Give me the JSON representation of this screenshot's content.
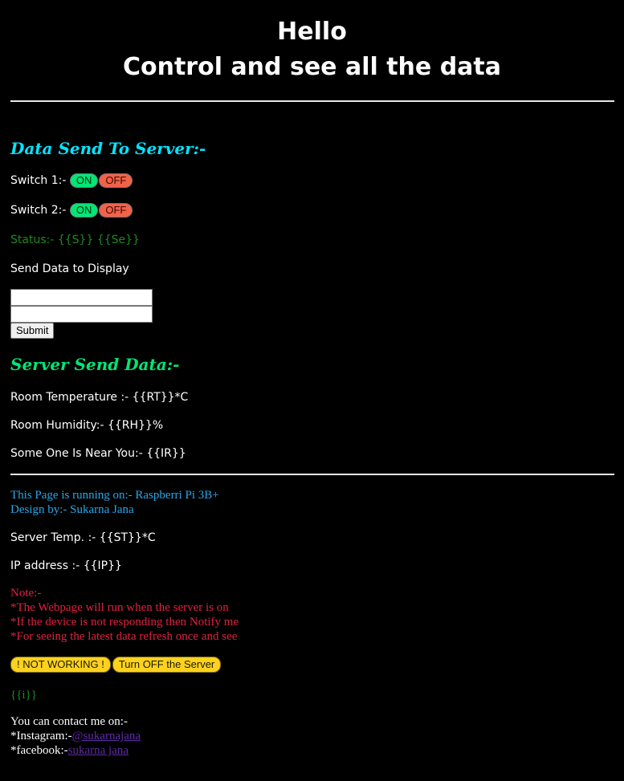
{
  "header": {
    "title": "Hello",
    "subtitle": "Control and see all the data"
  },
  "send_section": {
    "heading": "Data Send To Server:-",
    "switches": [
      {
        "label": "Switch 1:-",
        "on_label": "ON",
        "off_label": "OFF"
      },
      {
        "label": "Switch 2:-",
        "on_label": "ON",
        "off_label": "OFF"
      }
    ],
    "status": "Status:- {{S}} {{Se}}",
    "display_label": "Send Data to Display",
    "field1": {
      "value": "",
      "placeholder": ""
    },
    "field2": {
      "value": "",
      "placeholder": ""
    },
    "submit_label": "Submit"
  },
  "receive_section": {
    "heading": "Server Send Data:-",
    "room_temperature": "Room Temperature :- {{RT}}*C",
    "room_humidity": "Room Humidity:- {{RH}}%",
    "near_you": "Some One Is Near You:- {{IR}}"
  },
  "footer": {
    "running_on": "This Page is running on:- Raspberri Pi 3B+",
    "design_by": "Design by:- Sukarna Jana",
    "server_temp": "Server Temp. :- {{ST}}*C",
    "ip_address": "IP address :- {{IP}}",
    "note_title": "Note:-",
    "notes": [
      "*The Webpage will run when the server is on",
      "*If the device is not responding then Notify me",
      "*For seeing the latest data refresh once and see"
    ],
    "not_working_label": "! NOT WORKING !",
    "turn_off_label": "Turn OFF the Server",
    "template_var": "{{i}}",
    "contact_title": "You can contact me on:-",
    "instagram_prefix": "*Instagram:-",
    "instagram_handle": "@sukarnajana",
    "facebook_prefix": "*facebook:-",
    "facebook_handle": "sukarna jana"
  },
  "colors": {
    "background": "#000000",
    "heading_send": "#00e5ff",
    "heading_receive": "#00e676",
    "status_text": "#1e8a1e",
    "info_text": "#2aa7e8",
    "note_text": "#e0213c",
    "button_yellow": "#ffd21f",
    "link": "#5e2ca5"
  }
}
